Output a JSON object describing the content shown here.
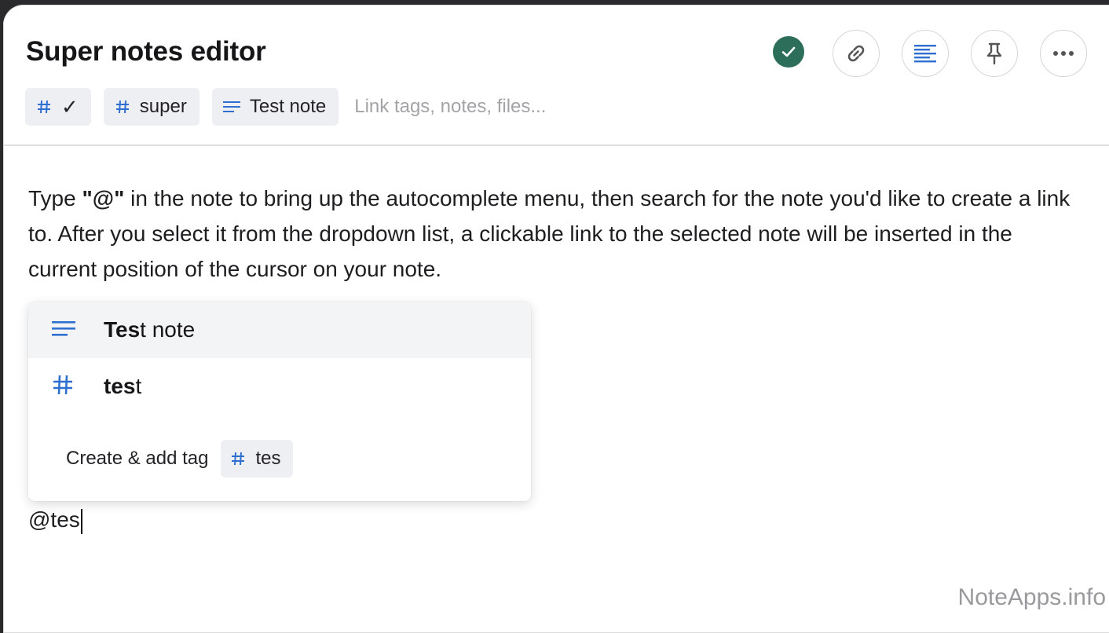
{
  "editor": {
    "title": "Super notes editor",
    "actions": {
      "saved_icon": "check-circle-icon",
      "link_icon": "link-icon",
      "format_icon": "align-left-icon",
      "pin_icon": "pin-icon",
      "more_icon": "more-icon"
    },
    "chips": [
      {
        "icon": "hash-icon",
        "label": "✓"
      },
      {
        "icon": "hash-icon",
        "label": "super"
      },
      {
        "icon": "note-icon",
        "label": "Test note"
      }
    ],
    "link_placeholder": "Link tags, notes, files...",
    "body": {
      "pre": "Type ",
      "bold": "\"@\"",
      "post": " in the note to bring up the autocomplete menu, then search for the note you'd like to create a link to. After you select it from the dropdown list, a clickable link to the selected note will be inserted in the current position of the cursor on your note."
    },
    "autocomplete": {
      "items": [
        {
          "icon": "note-icon",
          "match": "Tes",
          "rest": "t note",
          "selected": true
        },
        {
          "icon": "hash-icon",
          "match": "tes",
          "rest": "t",
          "selected": false
        }
      ],
      "create_label": "Create & add tag",
      "create_tag": "tes"
    },
    "typed_text": "@tes"
  },
  "watermark": "NoteApps.info",
  "colors": {
    "accent": "#2f6fd0",
    "saved": "#2d6e5b",
    "chip_bg": "#eeeff2"
  }
}
